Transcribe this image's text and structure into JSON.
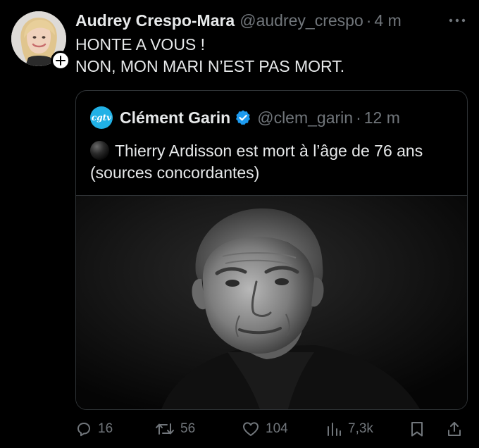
{
  "tweet": {
    "author_name": "Audrey Crespo-Mara",
    "author_handle": "@audrey_crespo",
    "separator": "·",
    "time": "4 m",
    "lines": [
      "HONTE A VOUS !",
      "NON, MON MARI N’EST PAS MORT."
    ],
    "avatar_icon": "profile-photo",
    "follow_icon": "plus-icon",
    "more_icon": "more-dots-icon"
  },
  "quote": {
    "avatar_text": "cgtv",
    "avatar_color": "#21b1e6",
    "author_name": "Clément Garin",
    "verified_icon": "verified-badge-icon",
    "verified_color": "#1d9bf0",
    "author_handle": "@clem_garin",
    "separator": "·",
    "time": "12 m",
    "emoji_icon": "black-circle-icon",
    "text": "Thierry Ardisson est mort à l’âge de 76 ans (sources concordantes)",
    "media": "black-and-white-portrait-photo"
  },
  "actions": {
    "reply": {
      "icon": "reply-icon",
      "count": "16"
    },
    "retweet": {
      "icon": "retweet-icon",
      "count": "56"
    },
    "like": {
      "icon": "heart-icon",
      "count": "104"
    },
    "views": {
      "icon": "views-icon",
      "count": "7,3k"
    },
    "bookmark": {
      "icon": "bookmark-icon"
    },
    "share": {
      "icon": "share-icon"
    }
  },
  "colors": {
    "background": "#000000",
    "text": "#e7e9ea",
    "secondary": "#71767b",
    "border": "#2f3336"
  }
}
